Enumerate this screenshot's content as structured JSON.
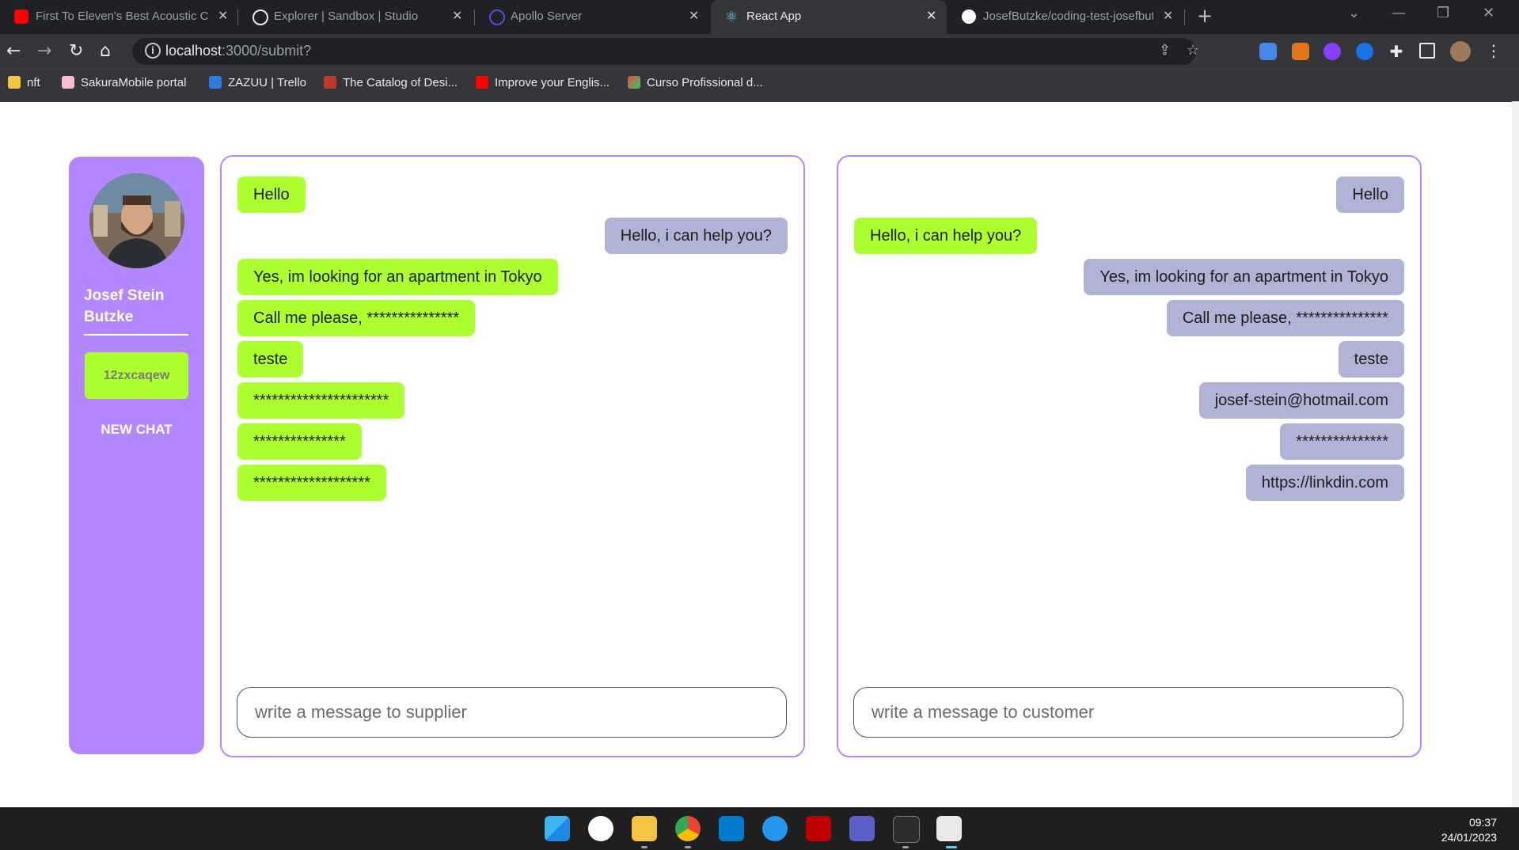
{
  "browser": {
    "tabs": [
      {
        "title": "First To Eleven's Best Acoustic Co",
        "icon": "youtube-icon",
        "active": false
      },
      {
        "title": "Explorer | Sandbox | Studio",
        "icon": "apollo-studio-icon",
        "active": false
      },
      {
        "title": "Apollo Server",
        "icon": "apollo-icon",
        "active": false
      },
      {
        "title": "React App",
        "icon": "react-icon",
        "active": true
      },
      {
        "title": "JosefButzke/coding-test-josefbut",
        "icon": "github-icon",
        "active": false
      }
    ],
    "url_host": "localhost",
    "url_path": ":3000/submit?",
    "bookmarks": [
      {
        "label": "nft",
        "icon": "folder-icon"
      },
      {
        "label": "SakuraMobile portal",
        "icon": "sakura-icon"
      },
      {
        "label": "ZAZUU | Trello",
        "icon": "trello-icon"
      },
      {
        "label": "The Catalog of Desi...",
        "icon": "catalog-icon"
      },
      {
        "label": "Improve your Englis...",
        "icon": "youtube-icon"
      },
      {
        "label": "Curso Profissional d...",
        "icon": "course-icon"
      }
    ]
  },
  "sidebar": {
    "user_name": "Josef Stein Butzke",
    "chat_id": "12zxcaqew",
    "new_chat_label": "NEW CHAT"
  },
  "supplier_panel": {
    "messages": [
      {
        "text": "Hello",
        "side": "left",
        "kind": "mine"
      },
      {
        "text": "Hello, i can help you?",
        "side": "right",
        "kind": "theirs"
      },
      {
        "text": "Yes, im looking for an apartment in Tokyo",
        "side": "left",
        "kind": "mine"
      },
      {
        "text": "Call me please, ***************",
        "side": "left",
        "kind": "mine"
      },
      {
        "text": "teste",
        "side": "left",
        "kind": "mine"
      },
      {
        "text": "**********************",
        "side": "left",
        "kind": "mine"
      },
      {
        "text": "***************",
        "side": "left",
        "kind": "mine"
      },
      {
        "text": "*******************",
        "side": "left",
        "kind": "mine"
      }
    ],
    "placeholder": "write a message to supplier"
  },
  "customer_panel": {
    "messages": [
      {
        "text": "Hello",
        "side": "right",
        "kind": "theirs"
      },
      {
        "text": "Hello, i can help you?",
        "side": "left",
        "kind": "mine"
      },
      {
        "text": "Yes, im looking for an apartment in Tokyo",
        "side": "right",
        "kind": "theirs"
      },
      {
        "text": "Call me please, ***************",
        "side": "right",
        "kind": "theirs"
      },
      {
        "text": "teste",
        "side": "right",
        "kind": "theirs"
      },
      {
        "text": "josef-stein@hotmail.com",
        "side": "right",
        "kind": "theirs"
      },
      {
        "text": "***************",
        "side": "right",
        "kind": "theirs"
      },
      {
        "text": "https://linkdin.com",
        "side": "right",
        "kind": "theirs"
      }
    ],
    "placeholder": "write a message to customer"
  },
  "taskbar": {
    "time": "09:37",
    "date": "24/01/2023"
  },
  "colors": {
    "accent_purple": "#b388ff",
    "bubble_green": "#adff2f",
    "bubble_gray": "#b1b3d6"
  }
}
